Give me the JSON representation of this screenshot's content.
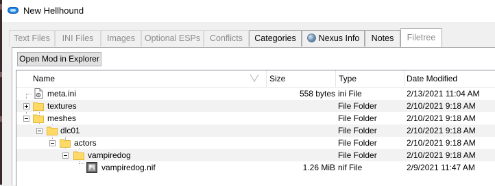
{
  "window": {
    "title": "New Hellhound"
  },
  "tabs": [
    {
      "label": "Text Files",
      "state": "disabled"
    },
    {
      "label": "INI Files",
      "state": "disabled"
    },
    {
      "label": "Images",
      "state": "disabled"
    },
    {
      "label": "Optional ESPs",
      "state": "disabled"
    },
    {
      "label": "Conflicts",
      "state": "disabled"
    },
    {
      "label": "Categories",
      "state": "enabled"
    },
    {
      "label": "Nexus Info",
      "state": "enabled",
      "icon": "globe-icon"
    },
    {
      "label": "Notes",
      "state": "enabled"
    },
    {
      "label": "Filetree",
      "state": "active"
    }
  ],
  "filetree": {
    "open_button": "Open Mod in Explorer",
    "columns": {
      "name": "Name",
      "size": "Size",
      "type": "Type",
      "date": "Date Modified"
    },
    "rows": [
      {
        "name": "meta.ini",
        "size": "558 bytes",
        "type": "ini File",
        "date": "2/13/2021 11:04 AM",
        "icon": "ini-file-icon"
      },
      {
        "name": "textures",
        "size": "",
        "type": "File Folder",
        "date": "2/10/2021 9:18 AM",
        "icon": "folder-icon",
        "expander": "collapsed"
      },
      {
        "name": "meshes",
        "size": "",
        "type": "File Folder",
        "date": "2/10/2021 9:18 AM",
        "icon": "folder-icon",
        "expander": "expanded"
      },
      {
        "name": "dlc01",
        "size": "",
        "type": "File Folder",
        "date": "2/10/2021 9:18 AM",
        "icon": "folder-icon",
        "expander": "expanded"
      },
      {
        "name": "actors",
        "size": "",
        "type": "File Folder",
        "date": "2/10/2021 9:18 AM",
        "icon": "folder-icon",
        "expander": "expanded"
      },
      {
        "name": "vampiredog",
        "size": "",
        "type": "File Folder",
        "date": "2/10/2021 9:18 AM",
        "icon": "folder-icon",
        "expander": "expanded"
      },
      {
        "name": "vampiredog.nif",
        "size": "1.26 MiB",
        "type": "nif File",
        "date": "2/9/2021 11:47 AM",
        "icon": "nif-file-icon"
      }
    ]
  },
  "colors": {
    "selection": "#f2f2f2",
    "folder": "#ffd966"
  }
}
